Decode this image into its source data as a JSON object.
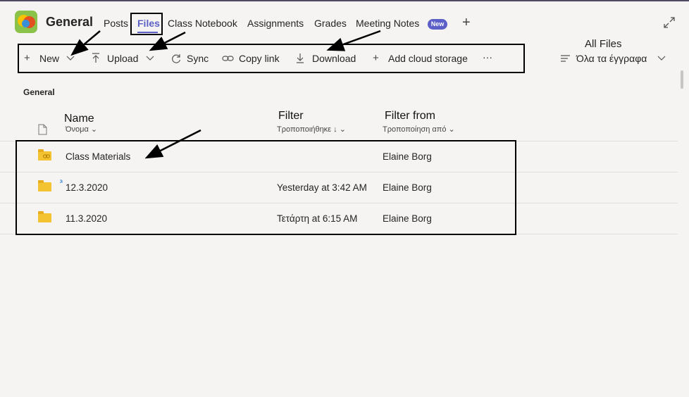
{
  "header": {
    "team_name": "General",
    "tabs": [
      "Posts",
      "Files",
      "Class Notebook",
      "Assignments",
      "Grades",
      "Meeting Notes"
    ],
    "new_badge": "New",
    "add_tab": "+"
  },
  "toolbar": {
    "new_label": "New",
    "upload_label": "Upload",
    "sync_label": "Sync",
    "copy_link_label": "Copy link",
    "download_label": "Download",
    "add_cloud_label": "Add cloud storage",
    "more_label": "···",
    "all_files_note": "All Files",
    "view_label": "Όλα τα έγγραφα"
  },
  "files": {
    "section_title": "General",
    "notes": {
      "name": "Name",
      "filter": "Filter",
      "filter_from": "Filter from"
    },
    "columns": {
      "name": "Όνομα",
      "modified": "Τροποποιήθηκε ↓",
      "modified_by": "Τροποποίηση από"
    },
    "rows": [
      {
        "name": "Class Materials",
        "modified": "",
        "modified_by": "Elaine Borg"
      },
      {
        "name": "12.3.2020",
        "modified": "Yesterday at 3:42 AM",
        "modified_by": "Elaine Borg"
      },
      {
        "name": "11.3.2020",
        "modified": "Τετάρτη at 6:15 AM",
        "modified_by": "Elaine Borg"
      }
    ]
  },
  "icons": {
    "app": "team-app-icon",
    "expand": "expand-icon",
    "plus": "plus-icon",
    "upload": "upload-icon",
    "sync": "sync-icon",
    "link": "link-icon",
    "download": "download-icon",
    "folder": "folder-icon",
    "file": "file-icon",
    "chevron": "chevron-down-icon",
    "view": "lines-icon"
  },
  "colors": {
    "accent": "#5b5fc7",
    "folder": "#f3c331",
    "background": "#f5f4f2"
  }
}
